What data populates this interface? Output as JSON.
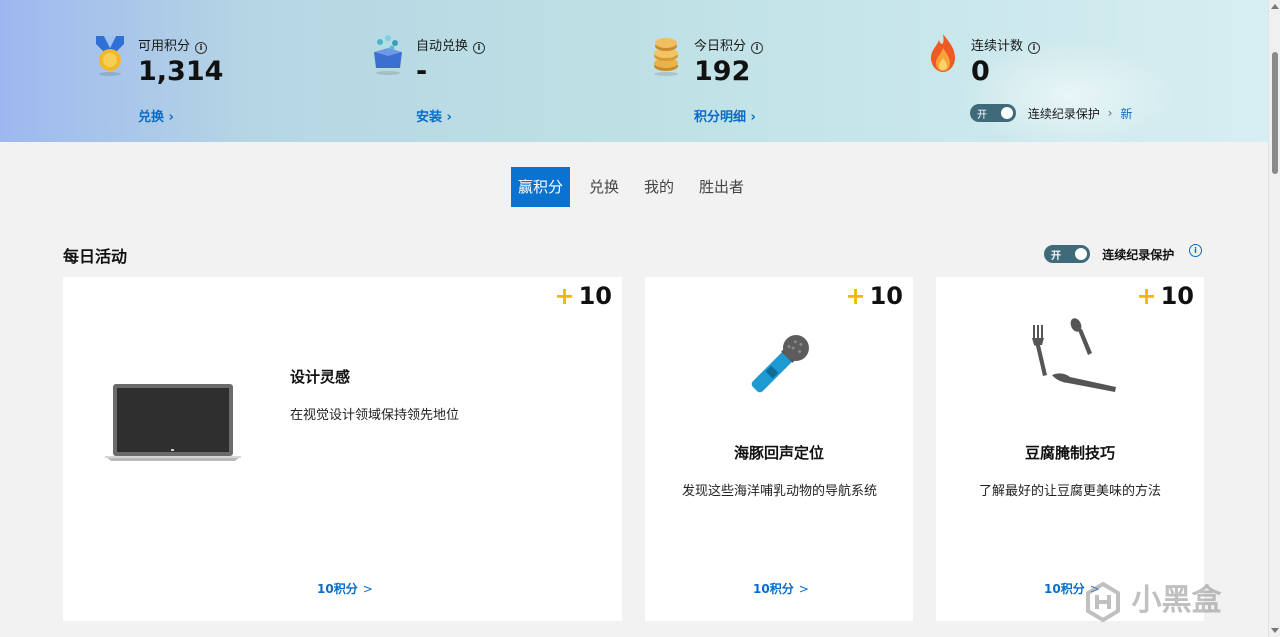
{
  "stats": [
    {
      "icon": "medal-icon",
      "label": "可用积分",
      "value": "1,314",
      "link": "兑换"
    },
    {
      "icon": "gift-box-icon",
      "label": "自动兑换",
      "value": "-",
      "link": "安装"
    },
    {
      "icon": "coin-stack-icon",
      "label": "今日积分",
      "value": "192",
      "link": "积分明细"
    },
    {
      "icon": "flame-icon",
      "label": "连续计数",
      "value": "0",
      "link": ""
    }
  ],
  "streak_protection": {
    "toggle_text": "开",
    "label": "连续纪录保护",
    "chevron": "›",
    "new_badge": "新"
  },
  "tabs": [
    "赢积分",
    "兑换",
    "我的",
    "胜出者"
  ],
  "active_tab": "赢积分",
  "section": {
    "title": "每日活动",
    "toggle_text": "开",
    "protect_label": "连续纪录保护",
    "info": "i"
  },
  "cards": [
    {
      "image": "laptop-icon",
      "points_plus": "+",
      "points": "10",
      "title": "设计灵感",
      "desc": "在视觉设计领域保持领先地位",
      "link": "10积分",
      "chevron": ">"
    },
    {
      "image": "microphone-icon",
      "points_plus": "+",
      "points": "10",
      "title": "海豚回声定位",
      "desc": "发现这些海洋哺乳动物的导航系统",
      "link": "10积分",
      "chevron": ">"
    },
    {
      "image": "cutlery-icon",
      "points_plus": "+",
      "points": "10",
      "title": "豆腐腌制技巧",
      "desc": "了解最好的让豆腐更美味的方法",
      "link": "10积分",
      "chevron": ">"
    }
  ],
  "watermark": "小黑盒",
  "colors": {
    "accent": "#0a73d1",
    "link": "#0a6cc7",
    "plus": "#f2b705",
    "toggle": "#3f6a7a"
  }
}
